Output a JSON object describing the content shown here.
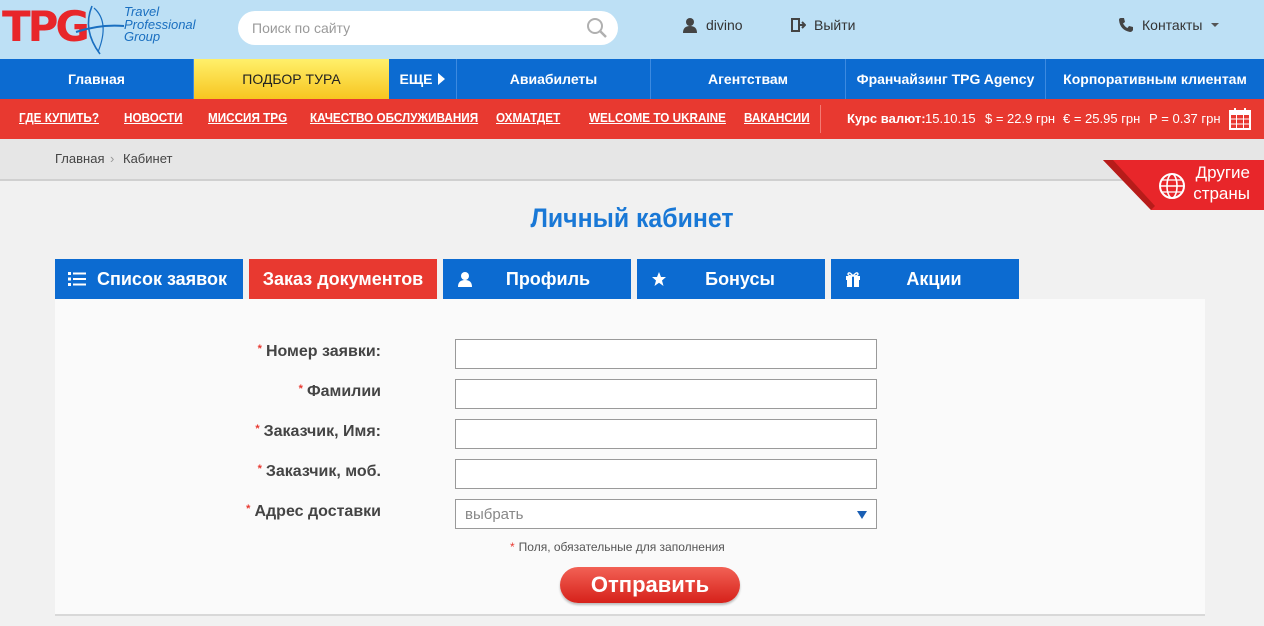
{
  "logo": {
    "mark": "TPG",
    "line1": "Travel",
    "line2": "Professional",
    "line3": "Group"
  },
  "header": {
    "search_placeholder": "Поиск по сайту",
    "user_name": "divino",
    "logout_label": "Выйти",
    "contacts_label": "Контакты"
  },
  "main_nav": [
    {
      "label": "Главная"
    },
    {
      "label": "ПОДБОР ТУРА"
    },
    {
      "label": "ЕЩЕ"
    },
    {
      "label": "Авиабилеты"
    },
    {
      "label": "Агентствам"
    },
    {
      "label": "Франчайзинг TPG Agency"
    },
    {
      "label": "Корпоративным клиентам"
    }
  ],
  "sub_nav": [
    {
      "label": "ГДЕ КУПИТЬ?"
    },
    {
      "label": "НОВОСТИ"
    },
    {
      "label": "МИССИЯ TPG"
    },
    {
      "label": "КАЧЕСТВО ОБСЛУЖИВАНИЯ"
    },
    {
      "label": "ОХМАТДЕТ"
    },
    {
      "label": "WELCOME TO UKRAINE"
    },
    {
      "label": "ВАКАНСИИ"
    }
  ],
  "rates": {
    "label": "Курс валют:",
    "date": "15.10.15",
    "usd": "$ = 22.9 грн",
    "eur": "€ = 25.95 грн",
    "rub": "Р = 0.37 грн"
  },
  "breadcrumb": {
    "home": "Главная",
    "separator": "›",
    "current": "Кабинет"
  },
  "other_countries": {
    "line1": "Другие",
    "line2": "страны"
  },
  "page_title": "Личный кабинет",
  "tabs": [
    {
      "label": "Список заявок"
    },
    {
      "label": "Заказ документов"
    },
    {
      "label": "Профиль"
    },
    {
      "label": "Бонусы"
    },
    {
      "label": "Акции"
    }
  ],
  "form": {
    "required_mark": "*",
    "fields": [
      {
        "label": "Номер заявки:",
        "value": ""
      },
      {
        "label": "Фамилии",
        "value": ""
      },
      {
        "label": "Заказчик, Имя:",
        "value": ""
      },
      {
        "label": "Заказчик, моб.",
        "value": ""
      }
    ],
    "address_label": "Адрес доставки",
    "address_value": "выбрать",
    "required_note": "Поля, обязательные для заполнения",
    "submit_label": "Отправить"
  },
  "colors": {
    "blue": "#0c6bd1",
    "red": "#e83930",
    "header_bg": "#bde0f5",
    "title_blue": "#1978d6"
  }
}
